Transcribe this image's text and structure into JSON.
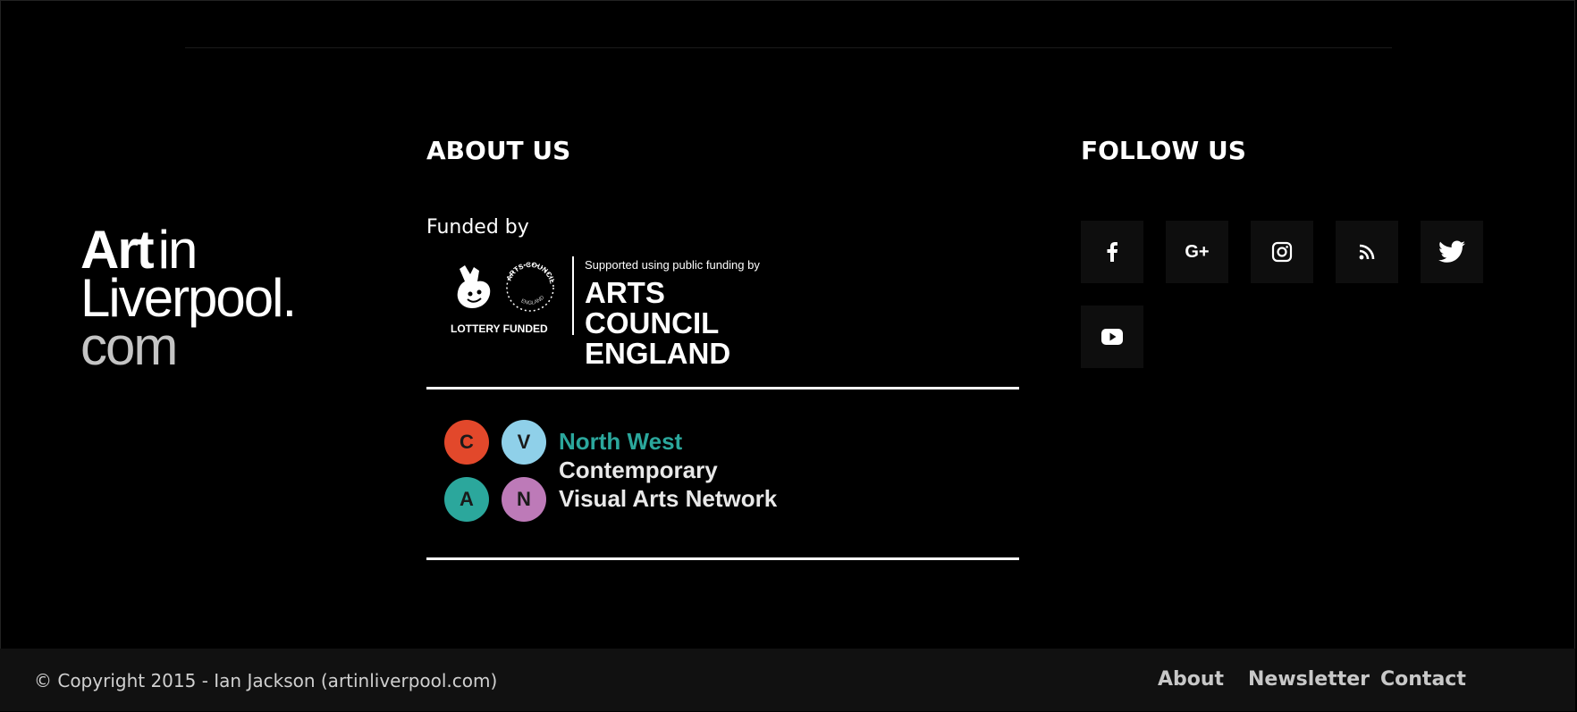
{
  "logo": {
    "line1_bold": "Art",
    "line1_light": "in",
    "line2": "Liverpool.",
    "line3": "com"
  },
  "about": {
    "heading": "ABOUT US",
    "funded_by": "Funded by",
    "arts_council": {
      "supported_text": "Supported using public funding by",
      "name_line1": "ARTS COUNCIL",
      "name_line2": "ENGLAND",
      "lottery_text": "LOTTERY FUNDED",
      "circle_text_top": "ARTS COUNCIL",
      "circle_text_bottom": "ENGLAND"
    },
    "cvan": {
      "letters": [
        "C",
        "V",
        "A",
        "N"
      ],
      "line1": "North West",
      "line2": "Contemporary",
      "line3": "Visual Arts Network",
      "colors": {
        "c": "#e2482b",
        "v": "#8fd0e9",
        "a": "#2ba79c",
        "n": "#bd7ab8"
      }
    }
  },
  "follow": {
    "heading": "FOLLOW US",
    "social": [
      {
        "name": "facebook",
        "icon": "facebook-icon"
      },
      {
        "name": "google-plus",
        "icon": "google-plus-icon",
        "glyph": "G+"
      },
      {
        "name": "instagram",
        "icon": "instagram-icon"
      },
      {
        "name": "rss",
        "icon": "rss-icon"
      },
      {
        "name": "twitter",
        "icon": "twitter-icon"
      },
      {
        "name": "youtube",
        "icon": "youtube-icon"
      }
    ]
  },
  "footer": {
    "copyright": "© Copyright 2015 - Ian Jackson (artinliverpool.com)",
    "links": [
      "About",
      "Newsletter",
      "Contact"
    ]
  },
  "colors": {
    "background": "#000000",
    "bottom_bar": "#111111",
    "button_bg": "#0e0e0e"
  }
}
